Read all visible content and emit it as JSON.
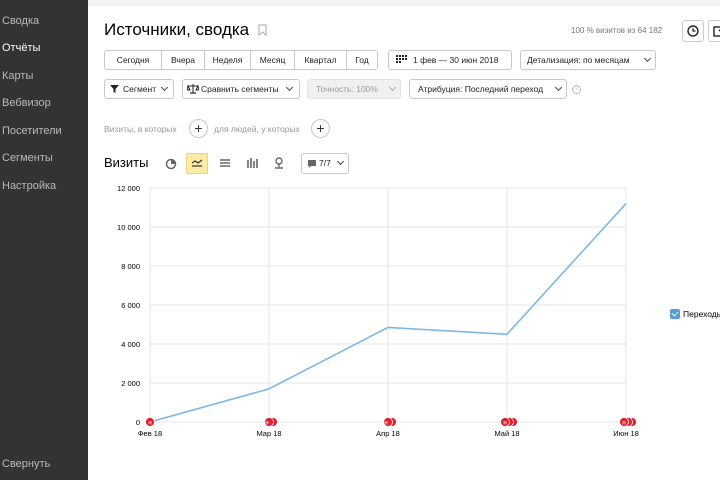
{
  "sidebar": {
    "items": [
      {
        "label": "Сводка",
        "active": false
      },
      {
        "label": "Отчёты",
        "active": true
      },
      {
        "label": "Карты",
        "active": false
      },
      {
        "label": "Вебвизор",
        "active": false
      },
      {
        "label": "Посетители",
        "active": false
      },
      {
        "label": "Сегменты",
        "active": false
      },
      {
        "label": "Настройка",
        "active": false
      }
    ],
    "collapse_label": "Свернуть"
  },
  "header": {
    "title": "Источники, сводка",
    "visits_info": "100 % визитов из 64 182"
  },
  "period": {
    "options": [
      "Сегодня",
      "Вчера",
      "Неделя",
      "Месяц",
      "Квартал",
      "Год"
    ],
    "date_range": "1 фев — 30 июн 2018",
    "detail": "Детализация: по месяцам"
  },
  "toolbar": {
    "segment": "Сегмент",
    "compare": "Сравнить сегменты",
    "accuracy": "Точность: 100%",
    "attribution": "Атрибуция: Последний переход",
    "help": "?"
  },
  "filters": {
    "visits_label": "Визиты, в которых",
    "people_label": "для людей, у которых"
  },
  "chart_controls": {
    "label": "Визиты",
    "chart_types": [
      "pie-chart-icon",
      "line-chart-icon",
      "area-chart-icon",
      "bar-chart-icon",
      "map-pin-icon"
    ],
    "active_chart_type": "line-chart-icon",
    "goals": "7/7"
  },
  "colors": {
    "sidebar_bg": "#333333",
    "line": "#7cb7e6",
    "annotation": "#e0202e",
    "active_toggle": "#fbeca5",
    "legend_check": "#5b9bd5"
  },
  "chart_data": {
    "type": "line",
    "categories": [
      "Фев 18",
      "Мар 18",
      "Апр 18",
      "Май 18",
      "Июн 18"
    ],
    "series": [
      {
        "name": "Переходы",
        "values": [
          0,
          1700,
          4850,
          4500,
          11200
        ]
      }
    ],
    "y_ticks": [
      "0",
      "2 000",
      "4 000",
      "6 000",
      "8 000",
      "10 000",
      "12 000"
    ],
    "ylim": [
      0,
      12000
    ],
    "grid": true,
    "annotation_marker_counts": [
      1,
      2,
      2,
      3,
      3
    ],
    "legend": {
      "label": "Переходы",
      "position": "right"
    }
  }
}
